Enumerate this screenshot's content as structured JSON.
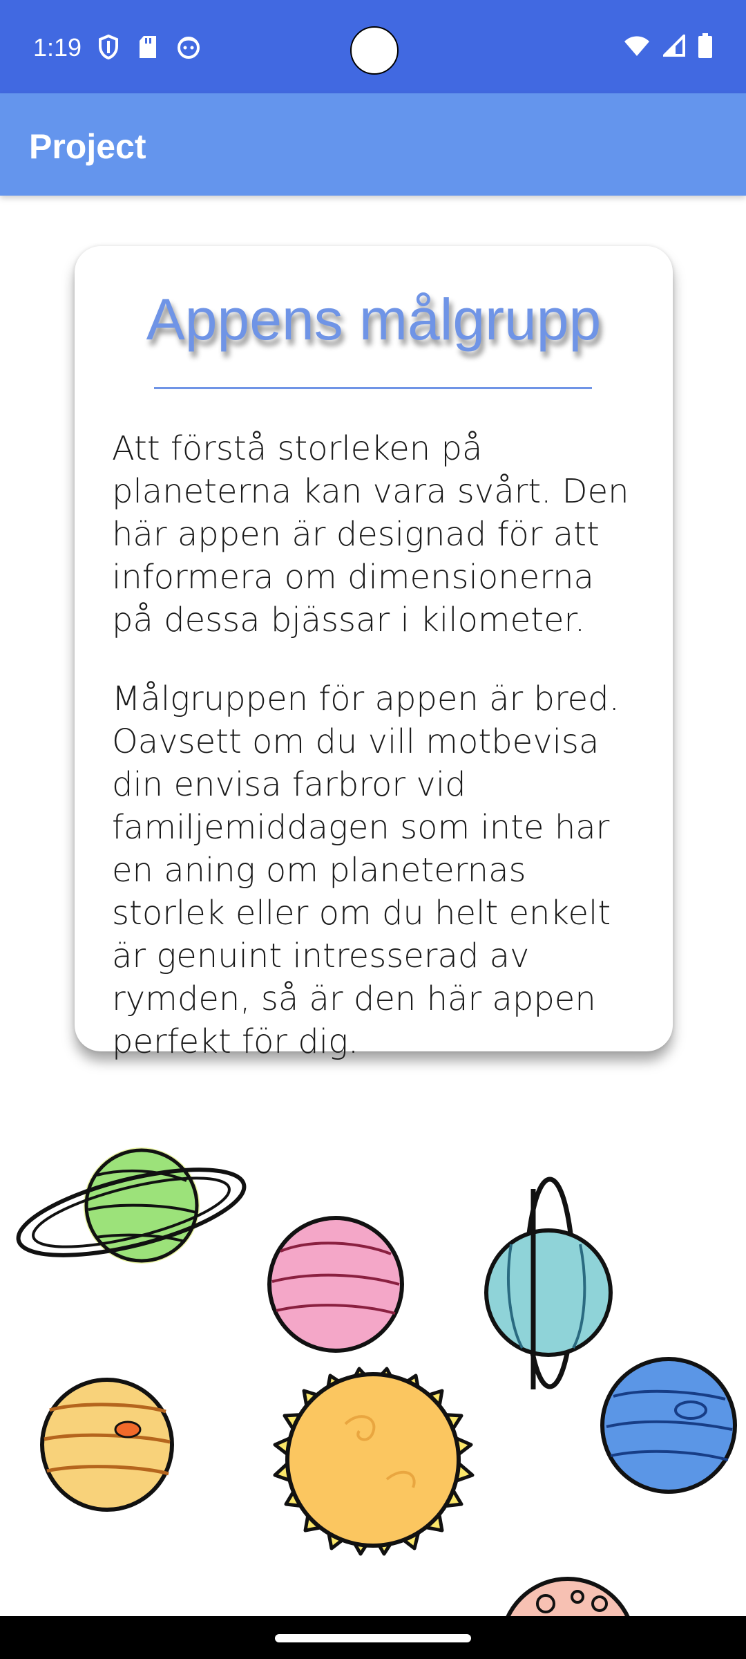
{
  "status_bar": {
    "time": "1:19",
    "icons_left": [
      "shield-icon",
      "sd-card-icon",
      "face-icon"
    ],
    "icons_right": [
      "wifi-icon",
      "signal-icon",
      "battery-icon"
    ]
  },
  "app_bar": {
    "title": "Project"
  },
  "card": {
    "heading": "Appens målgrupp",
    "paragraph1": "Att förstå storleken på planeterna kan vara svårt. Den här appen är designad för att informera om dimensionerna på dessa bjässar i kilometer.",
    "paragraph2": "Målgruppen för appen är bred. Oavsett om du vill motbevisa din envisa farbror vid familjemiddagen som inte har en aning om planeternas storlek eller om du helt enkelt är genuint intresserad av rymden, så är den här appen perfekt för dig."
  },
  "illustration": {
    "items": [
      "saturn-icon",
      "venus-icon",
      "uranus-icon",
      "jupiter-icon",
      "sun-icon",
      "neptune-icon",
      "mars-icon"
    ]
  },
  "colors": {
    "status_bar": "#4169e1",
    "app_bar": "#6495ed",
    "heading": "#6f94e6"
  }
}
